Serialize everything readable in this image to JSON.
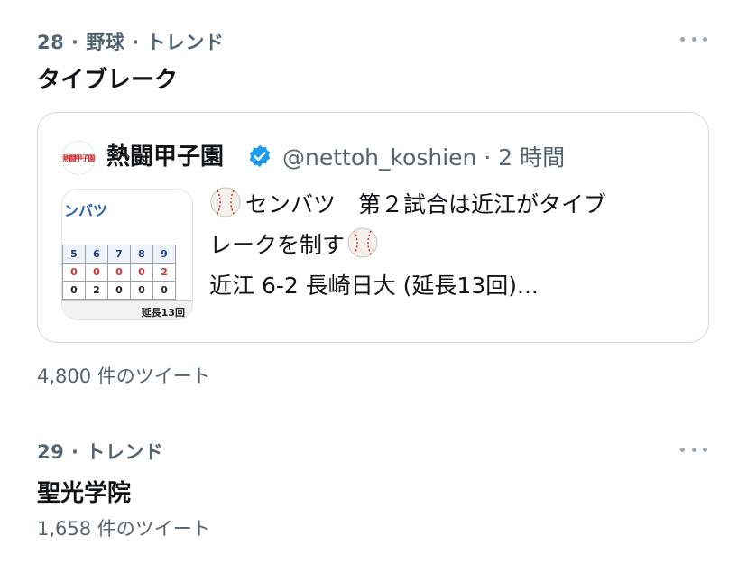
{
  "trends": [
    {
      "meta": "28 · 野球 · トレンド",
      "title": "タイブレーク",
      "count": "4,800 件のツイート",
      "tweet": {
        "account_name": "熱闘甲子園",
        "handle_time": "@nettoh_koshien · 2 時間",
        "logo_text": "熱闘甲子園",
        "text_line1": "センバツ　第２試合は近江がタイブ",
        "text_line2": "レークを制す",
        "text_line3": "近江 6-2 長崎日大 (延長13回)...",
        "thumbnail": {
          "title": "ンバツ",
          "innings": [
            "5",
            "6",
            "7",
            "8",
            "9"
          ],
          "row1": [
            "0",
            "0",
            "0",
            "0",
            "2"
          ],
          "row2": [
            "0",
            "2",
            "0",
            "0",
            "0"
          ],
          "note": "延長13回"
        }
      }
    },
    {
      "meta": "29 · トレンド",
      "title": "聖光学院",
      "count": "1,658 件のツイート"
    }
  ],
  "colors": {
    "verified": "#1d9bf0",
    "secondary_text": "#536471",
    "border": "#cfd9de"
  },
  "icons": {
    "more": "more-horizontal-icon",
    "verified": "verified-badge-icon",
    "baseball": "baseball-emoji-icon"
  }
}
